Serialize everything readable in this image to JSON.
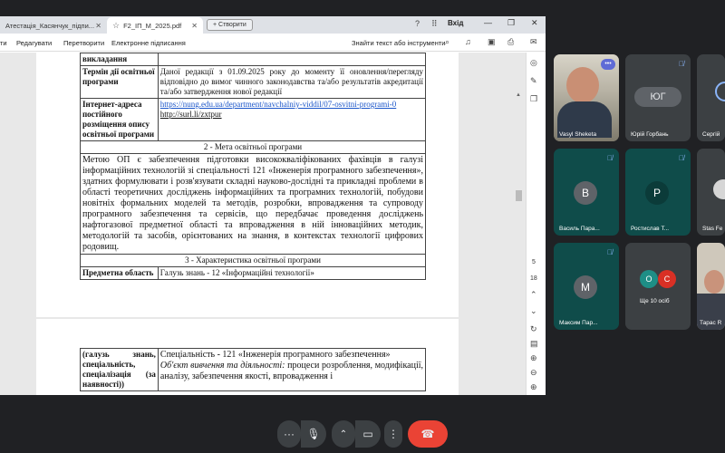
{
  "browser": {
    "tabs": [
      {
        "label": "Атестація_Касянчук_підпи..."
      },
      {
        "label": "F2_ІП_М_2025.pdf"
      }
    ],
    "new_tab_label": "+ Створити",
    "login_label": "Вхід"
  },
  "toolbar": {
    "edit": "Редагувати",
    "convert": "Перетворити",
    "esign": "Електронне підписання",
    "search_hint": "Знайти текст або інструменти"
  },
  "pdf": {
    "row_teaching_lang_label": "викладання",
    "row_term_label": "Термін дії освітньої програми",
    "row_term_text": "Даної редакції з 01.09.2025 року до моменту її оновлення/перегляду відповідно до вимог чинного законодавства та/або результатів акредитації та/або затвердження нової редакції",
    "row_url_label": "Інтернет-адреса постійного розміщення опису освітньої програми",
    "row_url_link1": "https://nung.edu.ua/department/navchalniy-viddil/07-osvitni-programi-0",
    "row_url_link2": "http://surl.li/zxtpur",
    "section2_title": "2 - Мета освітньої програми",
    "section2_text": "Метою ОП є забезпечення підготовки висококваліфікованих фахівців в галузі інформаційних технологій зі спеціальності 121 «Інженерія програмного забезпечення», здатних формулювати і розв'язувати складні науково-дослідні та прикладні проблеми в області теоретичних досліджень інформаційних та програмних технологій, побудови новітніх формальних моделей та методів, розробки, впровадження та супроводу програмного забезпечення та сервісів, що передбачає проведення досліджень нафтогазової предметної області та впровадження в ній інноваційних методик, методологій та засобів, орієнтованих на знання, в контекстах технології цифрових родовищ.",
    "section3_title": "3 - Характеристика освітньої програми",
    "subject_label": "Предметна область",
    "subject_text": "Галузь знань - 12 «Інформаційні технології»",
    "page2_label": "(галузь знань, спеціальність, спеціалізація (за наявності))",
    "page2_line1": "Спеціальність - 121 «Інженерія програмного забезпечення»",
    "page2_line2_italic": "Об'єкт вивчення та діяльності:",
    "page2_line2_rest": " процеси розроблення, модифікації, аналізу, забезпечення якості, впровадження і"
  },
  "rightbar": {
    "page_current": "5",
    "page_total": "18"
  },
  "participants": [
    {
      "name": "Vasyl Sheketa",
      "type": "video"
    },
    {
      "name": "Юрій Горбань",
      "initials": "ЮГ",
      "muted": true
    },
    {
      "name": "Сергій",
      "muted": false
    },
    {
      "name": "Василь Пара...",
      "initials": "В",
      "muted": true
    },
    {
      "name": "Ростислав Т...",
      "initials": "Р",
      "muted": true
    },
    {
      "name": "Stas Fe",
      "muted": false
    },
    {
      "name": "Максим Пар...",
      "initials": "М",
      "muted": true
    },
    {
      "name": "Ще 10 осіб",
      "initials_a": "О",
      "initials_b": "С"
    },
    {
      "name": "Тарас R",
      "type": "video"
    }
  ],
  "colors": {
    "end_call": "#ea4335",
    "tile_bg": "#3c4043",
    "tile_teal": "#0f4c4a",
    "avatar_grey": "#5f6368",
    "avatar_teal": "#1e8e86",
    "avatar_red": "#d93025"
  }
}
